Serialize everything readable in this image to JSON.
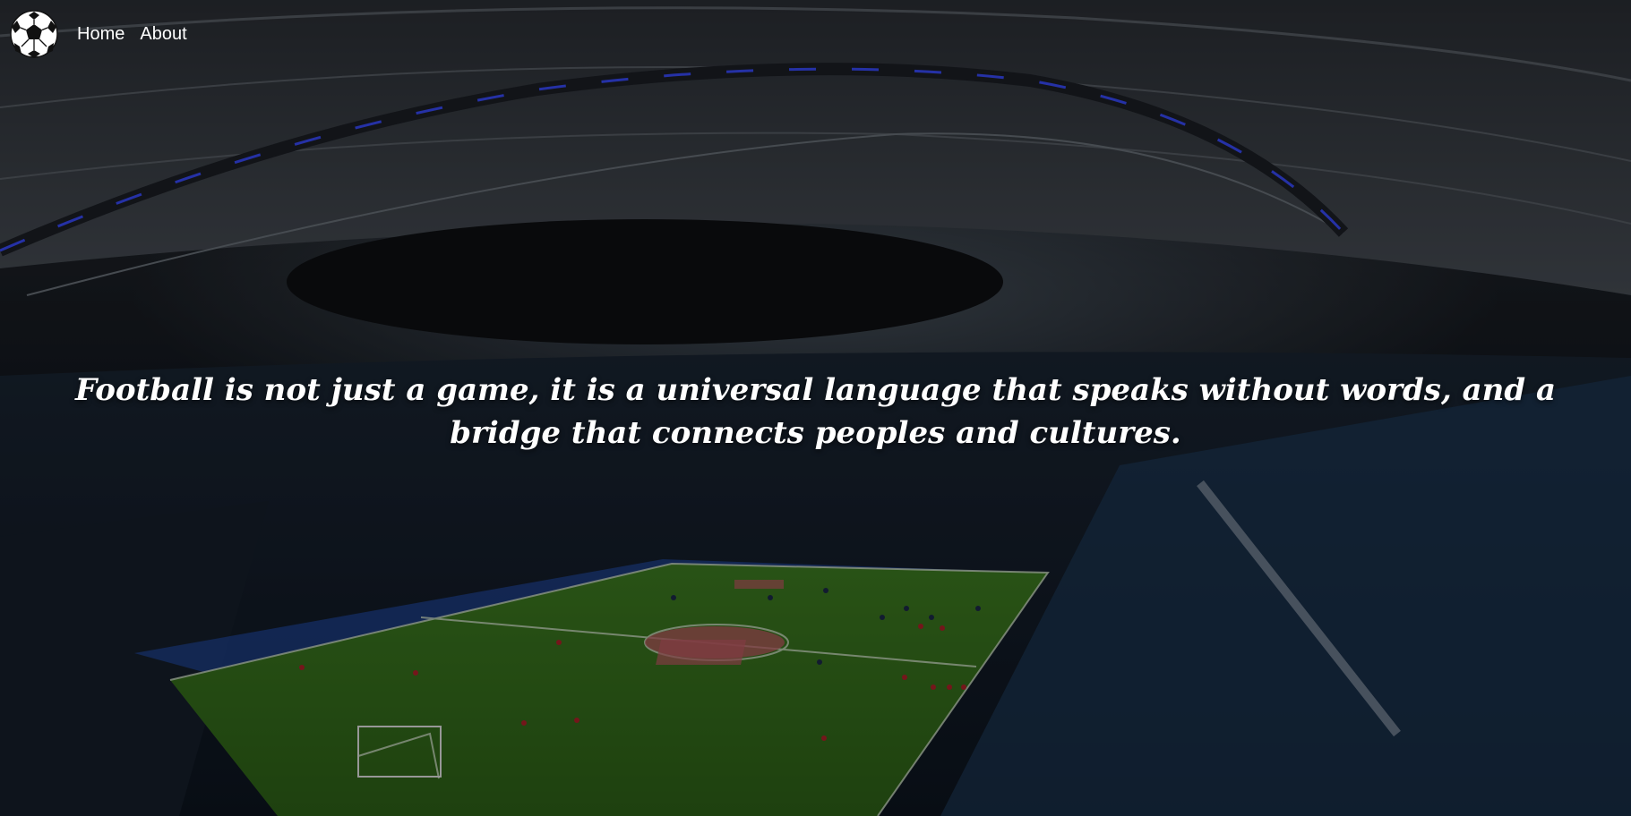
{
  "nav": {
    "logo_icon": "soccer-ball-icon",
    "items": [
      {
        "label": "Home"
      },
      {
        "label": "About"
      }
    ]
  },
  "hero": {
    "background_image": "football-stadium-night",
    "quote": "Football is not just a game, it is a universal language that speaks without words, and a bridge that connects peoples and cultures."
  },
  "colors": {
    "text": "#ffffff",
    "pitch": "#3f7d24",
    "overlay": "#000000",
    "stadium_lights": "#3a4cff"
  }
}
